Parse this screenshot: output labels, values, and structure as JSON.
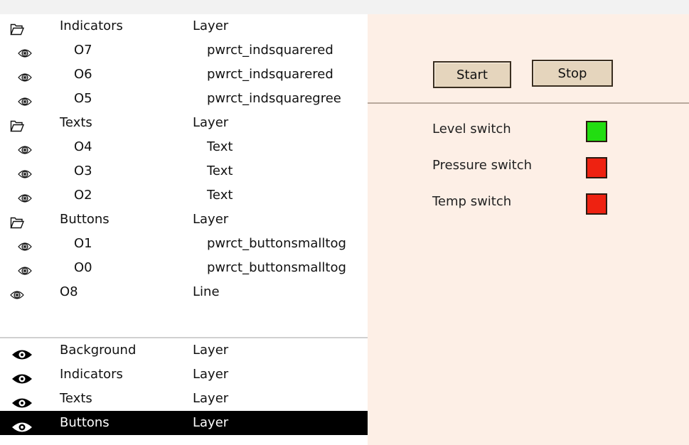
{
  "object_tree": [
    {
      "icon": "folder-icon",
      "name": "Indicators",
      "type": "Layer",
      "level": 0
    },
    {
      "icon": "object-icon",
      "name": "O7",
      "type": "pwrct_indsquarered",
      "level": 1
    },
    {
      "icon": "object-icon",
      "name": "O6",
      "type": "pwrct_indsquarered",
      "level": 1
    },
    {
      "icon": "object-icon",
      "name": "O5",
      "type": "pwrct_indsquaregree",
      "level": 1
    },
    {
      "icon": "folder-icon",
      "name": "Texts",
      "type": "Layer",
      "level": 0
    },
    {
      "icon": "object-icon",
      "name": "O4",
      "type": "Text",
      "level": 1
    },
    {
      "icon": "object-icon",
      "name": "O3",
      "type": "Text",
      "level": 1
    },
    {
      "icon": "object-icon",
      "name": "O2",
      "type": "Text",
      "level": 1
    },
    {
      "icon": "folder-icon",
      "name": "Buttons",
      "type": "Layer",
      "level": 0
    },
    {
      "icon": "object-icon",
      "name": "O1",
      "type": "pwrct_buttonsmalltog",
      "level": 1
    },
    {
      "icon": "object-icon",
      "name": "O0",
      "type": "pwrct_buttonsmalltog",
      "level": 1
    },
    {
      "icon": "object-icon",
      "name": "O8",
      "type": "Line",
      "level": 0
    }
  ],
  "layers": [
    {
      "icon": "eye-icon",
      "name": "Background",
      "type": "Layer",
      "selected": false
    },
    {
      "icon": "eye-icon",
      "name": "Indicators",
      "type": "Layer",
      "selected": false
    },
    {
      "icon": "eye-icon",
      "name": "Texts",
      "type": "Layer",
      "selected": false
    },
    {
      "icon": "eye-icon",
      "name": "Buttons",
      "type": "Layer",
      "selected": true
    }
  ],
  "canvas": {
    "start_label": "Start",
    "stop_label": "Stop",
    "indicators": [
      {
        "label": "Level switch",
        "color": "#22dd11"
      },
      {
        "label": "Pressure switch",
        "color": "#ee2211"
      },
      {
        "label": "Temp switch",
        "color": "#ee2211"
      }
    ]
  }
}
